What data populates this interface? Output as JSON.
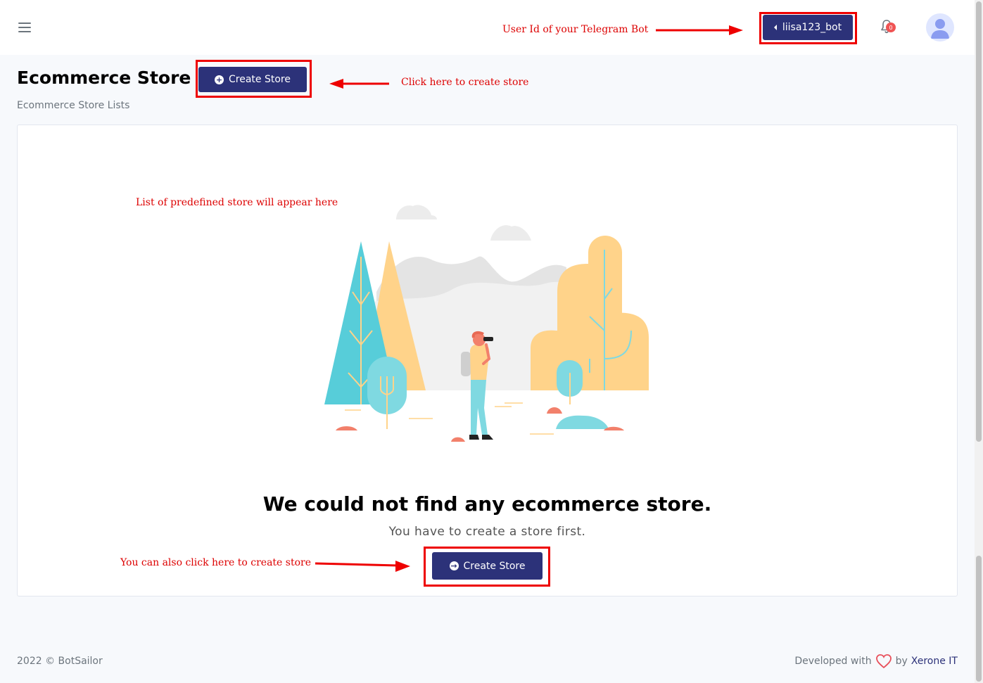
{
  "header": {
    "menu_icon": "hamburger-icon",
    "bot_label": "liisa123_bot",
    "notification_count": "0",
    "bell_icon": "bell-icon",
    "avatar_icon": "user-avatar-icon"
  },
  "page": {
    "title": "Ecommerce Store",
    "subtitle": "Ecommerce Store Lists",
    "create_button_label": "Create Store"
  },
  "empty_state": {
    "title": "We could not find any ecommerce store.",
    "message": "You have to create a store first.",
    "create_button_label": "Create Store"
  },
  "annotations": {
    "bot_id": "User Id of your Telegram Bot",
    "click_create": "Click here to create store",
    "predefined_list": "List of predefined store will appear here",
    "also_click": "You can also click here to create store"
  },
  "footer": {
    "copyright": "2022 © BotSailor",
    "developed_with": "Developed with",
    "by": "by",
    "company": "Xerone IT"
  },
  "colors": {
    "primary": "#2c3279",
    "annotation": "#dd0000",
    "background": "#f7f9fc"
  }
}
